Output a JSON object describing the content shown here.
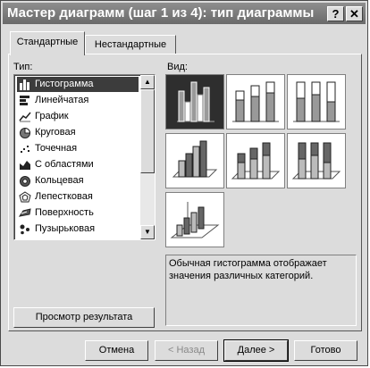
{
  "window": {
    "title": "Мастер диаграмм (шаг 1 из 4): тип диаграммы",
    "help_glyph": "?",
    "close_glyph": "✕"
  },
  "tabs": [
    {
      "label": "Стандартные",
      "active": true
    },
    {
      "label": "Нестандартные",
      "active": false
    }
  ],
  "type_list": {
    "label": "Тип:",
    "items": [
      {
        "label": "Гистограмма",
        "icon": "column-chart-icon",
        "selected": true
      },
      {
        "label": "Линейчатая",
        "icon": "bar-chart-icon"
      },
      {
        "label": "График",
        "icon": "line-chart-icon"
      },
      {
        "label": "Круговая",
        "icon": "pie-chart-icon"
      },
      {
        "label": "Точечная",
        "icon": "scatter-chart-icon"
      },
      {
        "label": "С областями",
        "icon": "area-chart-icon"
      },
      {
        "label": "Кольцевая",
        "icon": "doughnut-chart-icon"
      },
      {
        "label": "Лепестковая",
        "icon": "radar-chart-icon"
      },
      {
        "label": "Поверхность",
        "icon": "surface-chart-icon"
      },
      {
        "label": "Пузырьковая",
        "icon": "bubble-chart-icon"
      }
    ]
  },
  "view": {
    "label": "Вид:",
    "subtypes": [
      {
        "icon": "clustered-column-icon",
        "selected": true
      },
      {
        "icon": "stacked-column-icon"
      },
      {
        "icon": "percent-stacked-column-icon"
      },
      {
        "icon": "clustered-column-3d-icon"
      },
      {
        "icon": "stacked-column-3d-icon"
      },
      {
        "icon": "percent-stacked-column-3d-icon"
      },
      {
        "icon": "column-3d-icon"
      }
    ],
    "description": "Обычная гистограмма отображает значения различных категорий."
  },
  "preview_button": "Просмотр результата",
  "footer": {
    "cancel": "Отмена",
    "back": "< Назад",
    "next": "Далее >",
    "finish": "Готово"
  }
}
